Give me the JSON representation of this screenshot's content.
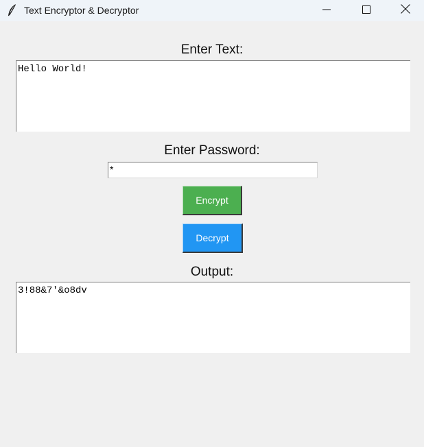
{
  "window": {
    "title": "Text Encryptor & Decryptor",
    "icon": "feather-icon",
    "controls": [
      "minimize-icon",
      "maximize-icon",
      "close-icon"
    ]
  },
  "input_section": {
    "label": "Enter Text:",
    "value": "Hello World!"
  },
  "password_section": {
    "label": "Enter Password:",
    "value": "*"
  },
  "buttons": {
    "encrypt_label": "Encrypt",
    "encrypt_color": "#4caf50",
    "decrypt_label": "Decrypt",
    "decrypt_color": "#2196f3"
  },
  "output_section": {
    "label": "Output:",
    "value": "3!88&7'&o8dv"
  }
}
